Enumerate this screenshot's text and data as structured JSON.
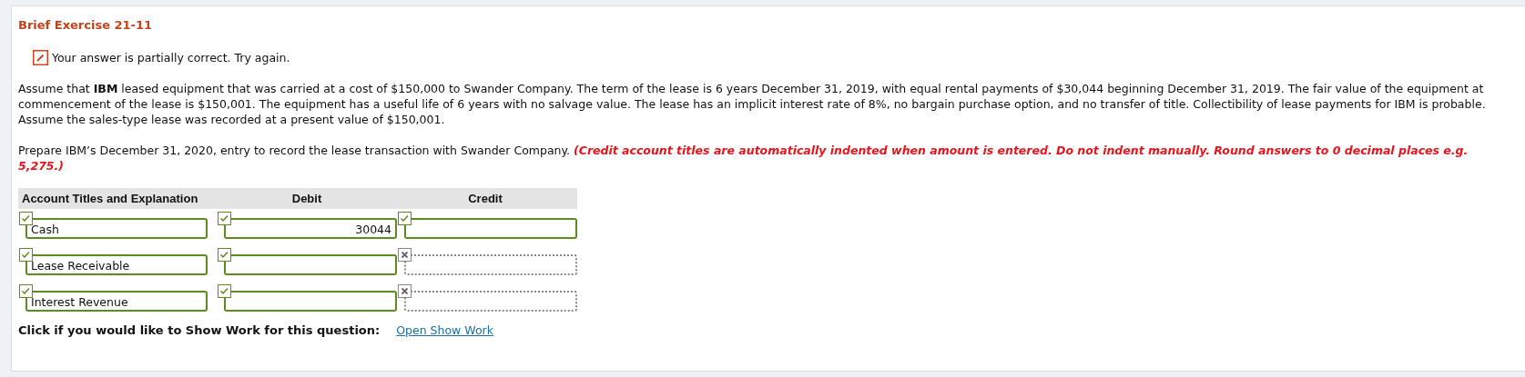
{
  "title": "Brief Exercise 21-11",
  "feedback": {
    "text": "Your answer is partially correct.  Try again."
  },
  "paragraphs": [
    "Assume that **IBM** leased equipment that was carried at a cost of $150,000 to Swander Company. The term of the lease is 6 years December 31, 2019, with equal rental payments of $30,044 beginning December 31, 2019. The fair value of the equipment at commencement of the lease is $150,001. The equipment has a useful life of 6 years with no salvage value. The lease has an implicit interest rate of 8%, no bargain purchase option, and no transfer of title. Collectibility of lease payments for IBM is probable. Assume the sales-type lease was recorded at a present value of $150,001."
  ],
  "instruction": {
    "text": "Prepare IBM’s December 31, 2020, entry to record the lease transaction with Swander Company.",
    "note": "(Credit account titles are automatically indented when amount is entered. Do not indent manually. Round answers to 0 decimal places e.g. 5,275.)"
  },
  "table": {
    "columns": [
      "Account Titles and Explanation",
      "Debit",
      "Credit"
    ],
    "rows": [
      {
        "account": {
          "value": "Cash",
          "correct": true
        },
        "debit": {
          "value": "30044",
          "correct": true
        },
        "credit": {
          "correct": true
        }
      },
      {
        "account": {
          "value": "Lease Receivable",
          "correct": true
        },
        "debit": {
          "correct": true
        },
        "credit": {
          "correct": false
        }
      },
      {
        "account": {
          "value": "Interest Revenue",
          "correct": true
        },
        "debit": {
          "correct": true
        },
        "credit": {
          "correct": false
        }
      }
    ]
  },
  "show_work": {
    "prompt": "Click if you would like to Show Work for this question:",
    "link": "Open Show Work"
  }
}
